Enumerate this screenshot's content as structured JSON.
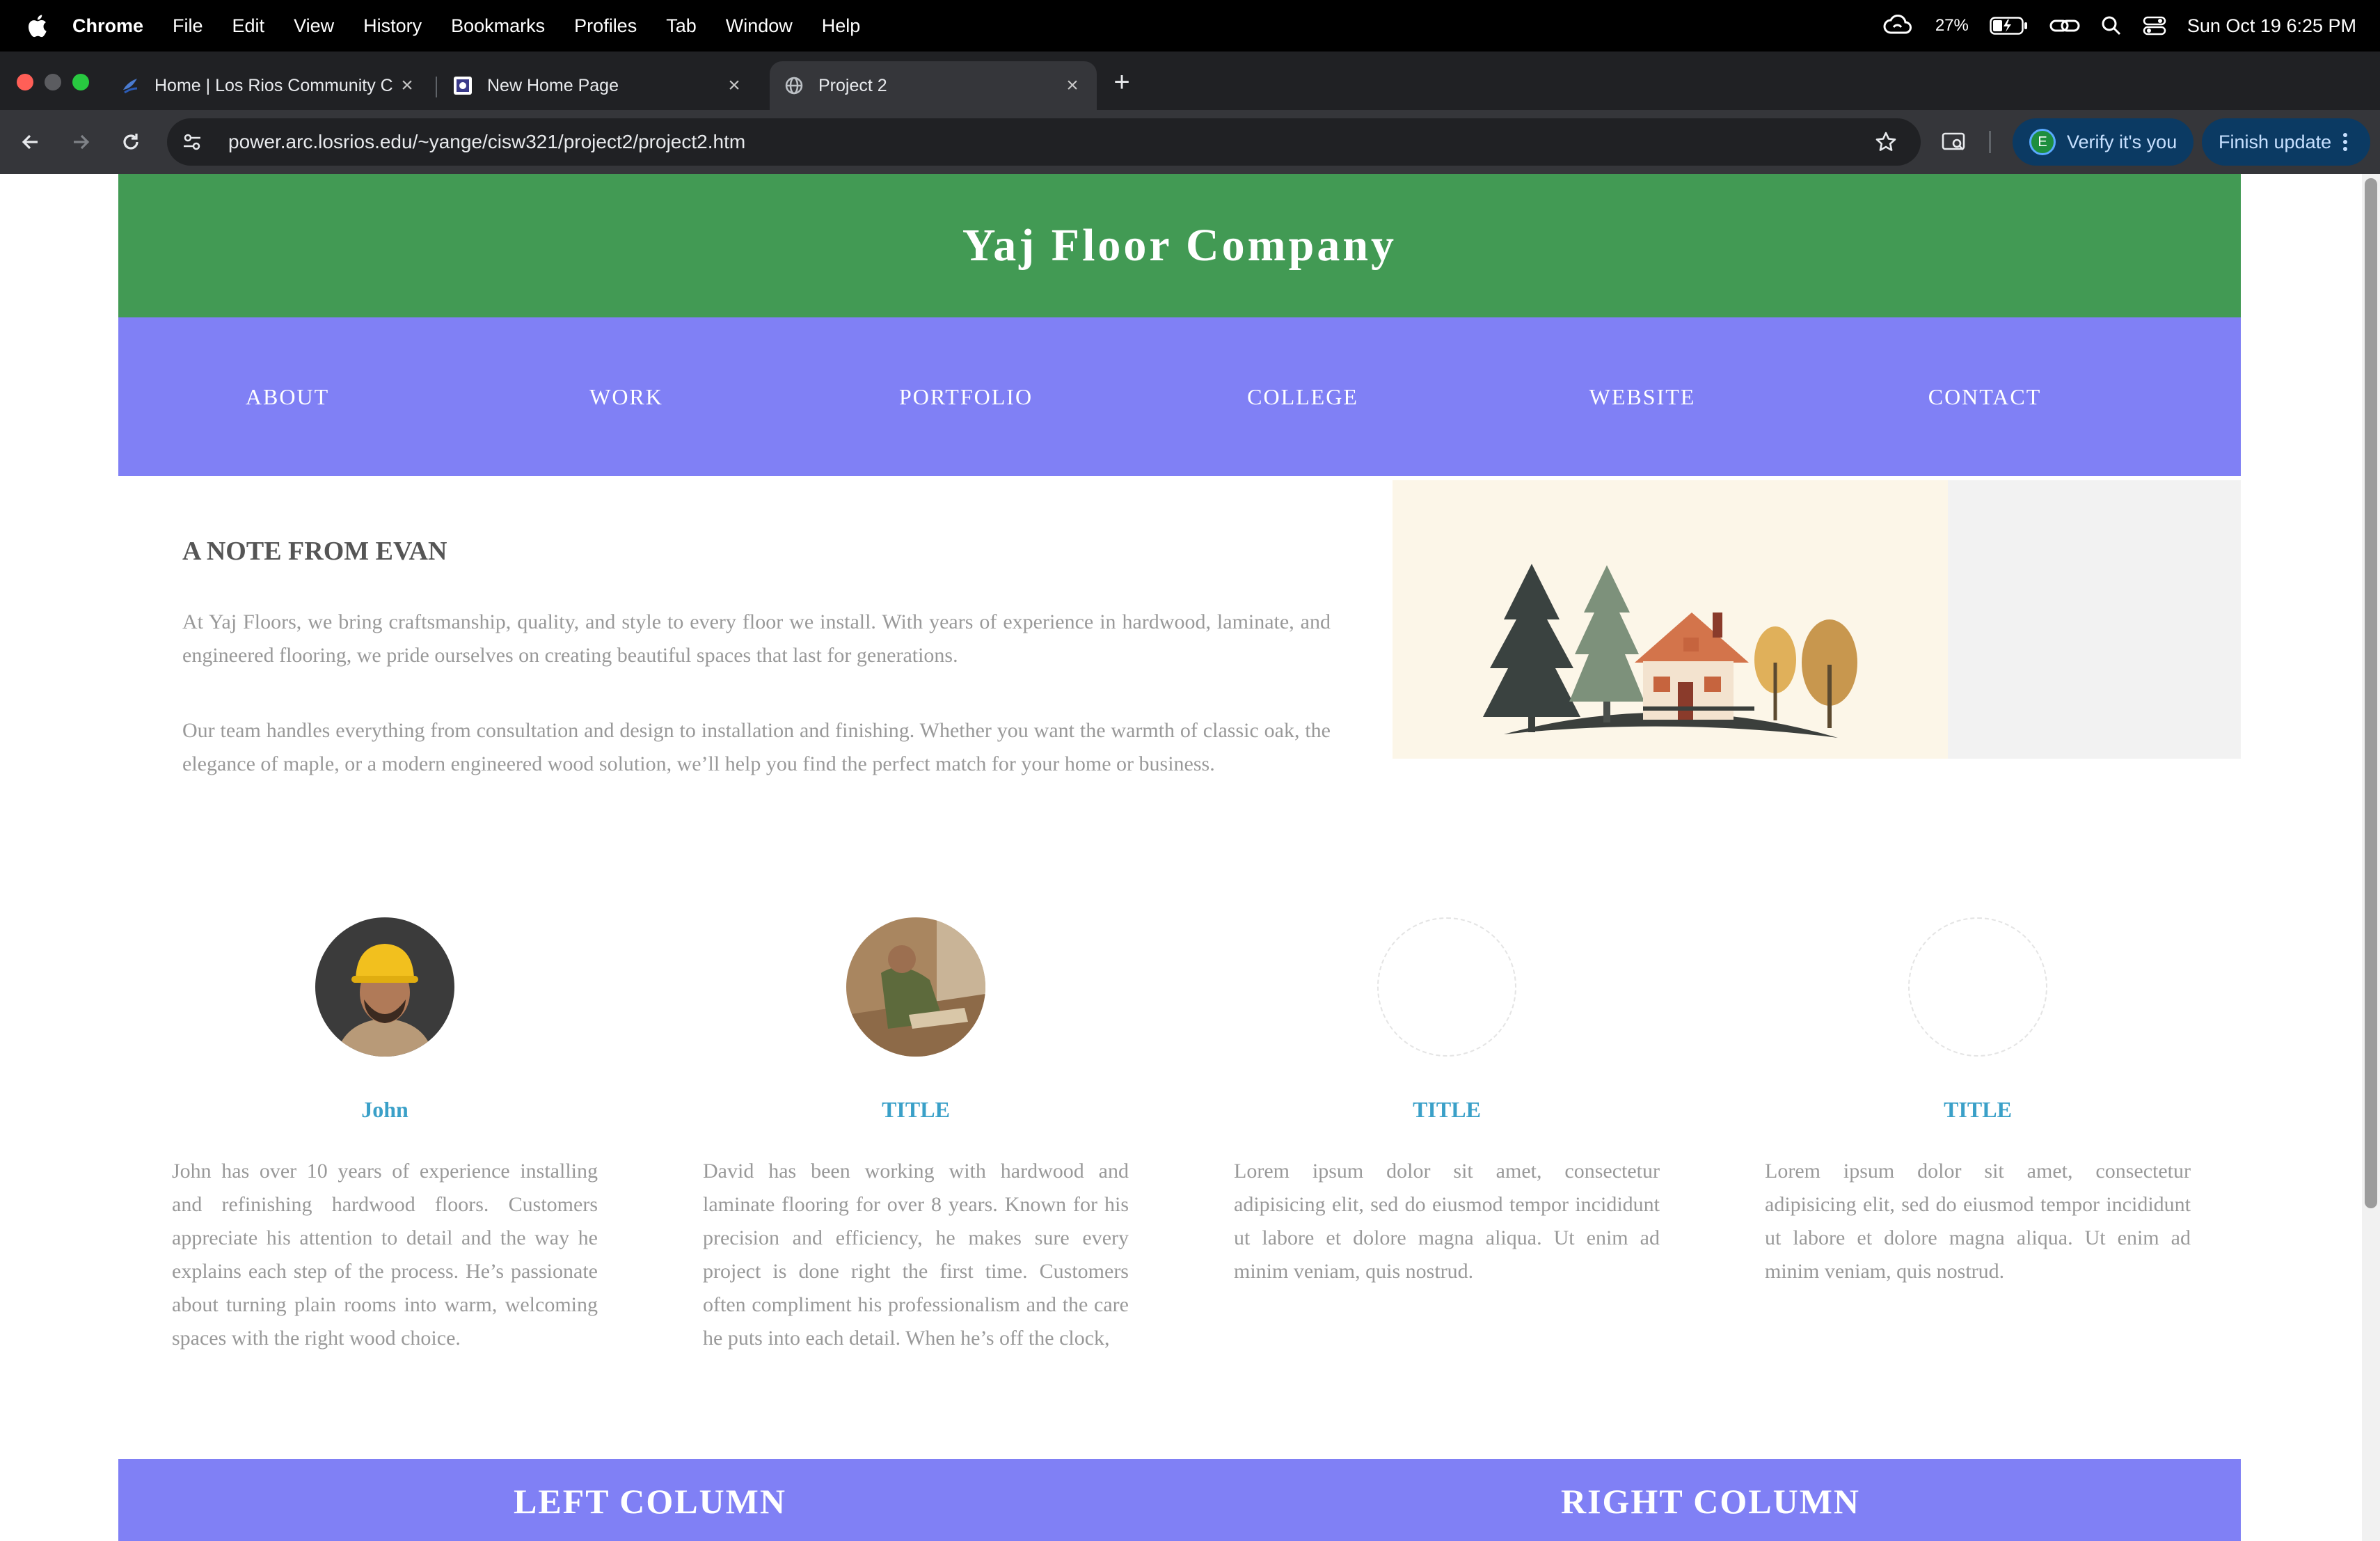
{
  "menubar": {
    "app_name": "Chrome",
    "items": [
      "File",
      "Edit",
      "View",
      "History",
      "Bookmarks",
      "Profiles",
      "Tab",
      "Window",
      "Help"
    ],
    "battery": "27%",
    "datetime": "Sun Oct 19  6:25 PM"
  },
  "tabs": [
    {
      "title": "Home | Los Rios Community C",
      "favicon": "los-rios-icon",
      "active": false
    },
    {
      "title": "New Home Page",
      "favicon": "page-icon",
      "active": false
    },
    {
      "title": "Project 2",
      "favicon": "globe-icon",
      "active": true
    }
  ],
  "toolbar": {
    "url": "power.arc.losrios.edu/~yange/cisw321/project2/project2.htm",
    "verify_label": "Verify it's you",
    "profile_initial": "E",
    "update_label": "Finish update"
  },
  "site": {
    "title": "Yaj Floor Company",
    "nav": [
      "ABOUT",
      "WORK",
      "PORTFOLIO",
      "COLLEGE",
      "WEBSITE",
      "CONTACT"
    ],
    "note_title": "A NOTE FROM EVAN",
    "note_paragraphs": [
      "At Yaj Floors, we bring craftsmanship, quality, and style to every floor we install. With years of experience in hardwood, laminate, and engineered flooring, we pride ourselves on creating beautiful spaces that last for generations.",
      "Our team handles everything from consultation and design to installation and finishing. Whether you want the warmth of classic oak, the elegance of maple, or a modern engineered wood solution, we’ll help you find the perfect match for your home or business."
    ],
    "team": [
      {
        "name": "John",
        "bio": "John has over 10 years of experience installing and refinishing hardwood floors. Customers appreciate his attention to detail and the way he explains each step of the process. He’s passionate about turning plain rooms into warm, welcoming spaces with the right wood choice."
      },
      {
        "name": "TITLE",
        "bio": "David has been working with hardwood and laminate flooring for over 8 years. Known for his precision and efficiency, he makes sure every project is done right the first time. Customers often compliment his professionalism and the care he puts into each detail. When he’s off the clock,"
      },
      {
        "name": "TITLE",
        "bio": "Lorem ipsum dolor sit amet, consectetur adipisicing elit, sed do eiusmod tempor incididunt ut labore et dolore magna aliqua. Ut enim ad minim veniam, quis nostrud."
      },
      {
        "name": "TITLE",
        "bio": "Lorem ipsum dolor sit amet, consectetur adipisicing elit, sed do eiusmod tempor incididunt ut labore et dolore magna aliqua. Ut enim ad minim veniam, quis nostrud."
      }
    ],
    "footer_left": "LEFT COLUMN",
    "footer_right": "RIGHT COLUMN"
  },
  "colors": {
    "header_green": "#429a54",
    "nav_purple": "#8080f5",
    "title_blue": "#3aa0c8"
  }
}
